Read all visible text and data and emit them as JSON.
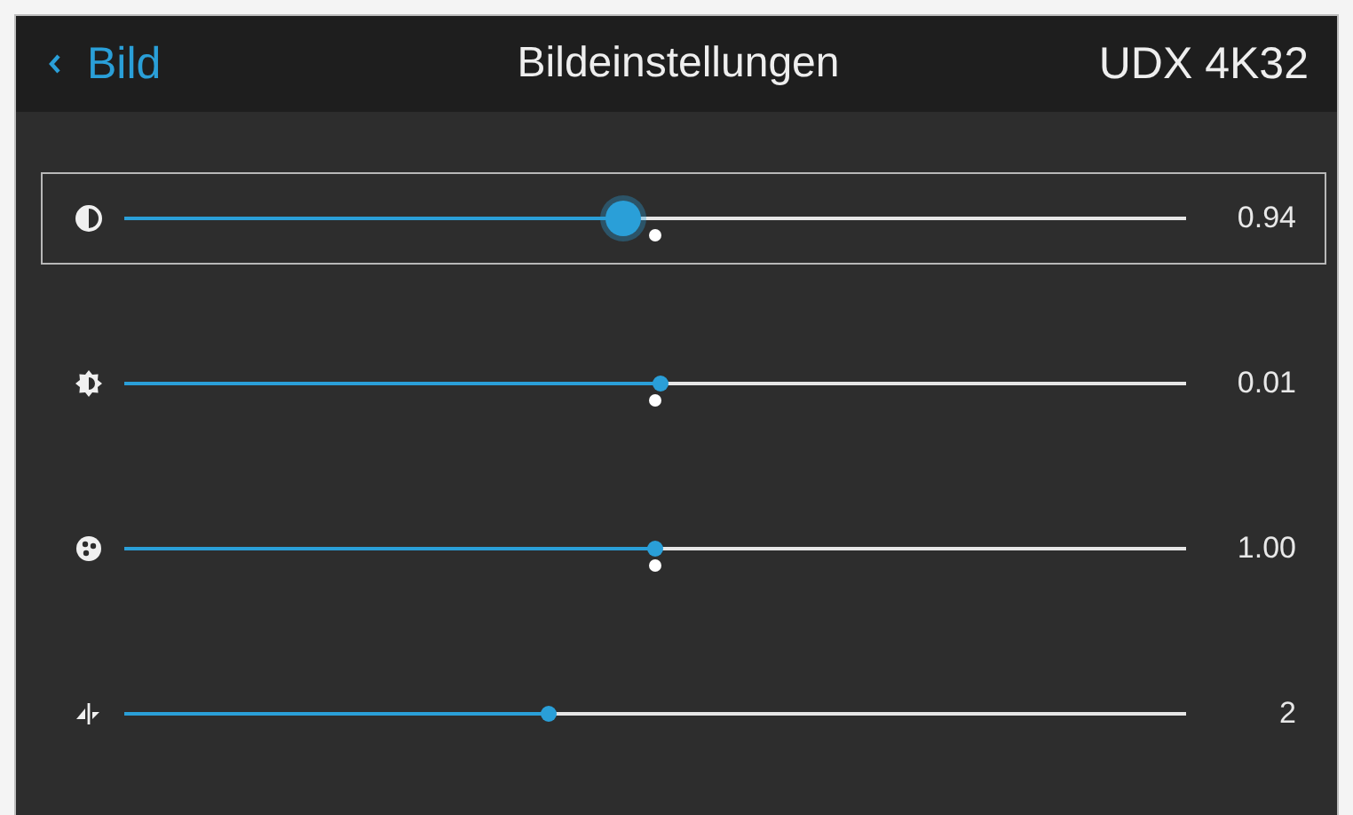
{
  "header": {
    "back_label": "Bild",
    "title": "Bildeinstellungen",
    "device": "UDX 4K32"
  },
  "sliders": [
    {
      "kind": "contrast",
      "selected": true,
      "level": 0.47,
      "default_mark": true,
      "reading": "0.94"
    },
    {
      "kind": "brightness",
      "selected": false,
      "level": 0.505,
      "default_mark": true,
      "reading": "0.01"
    },
    {
      "kind": "saturation",
      "selected": false,
      "level": 0.5,
      "default_mark": true,
      "reading": "1.00"
    },
    {
      "kind": "sharpness",
      "selected": false,
      "level": 0.4,
      "default_mark": false,
      "reading": "2"
    }
  ]
}
